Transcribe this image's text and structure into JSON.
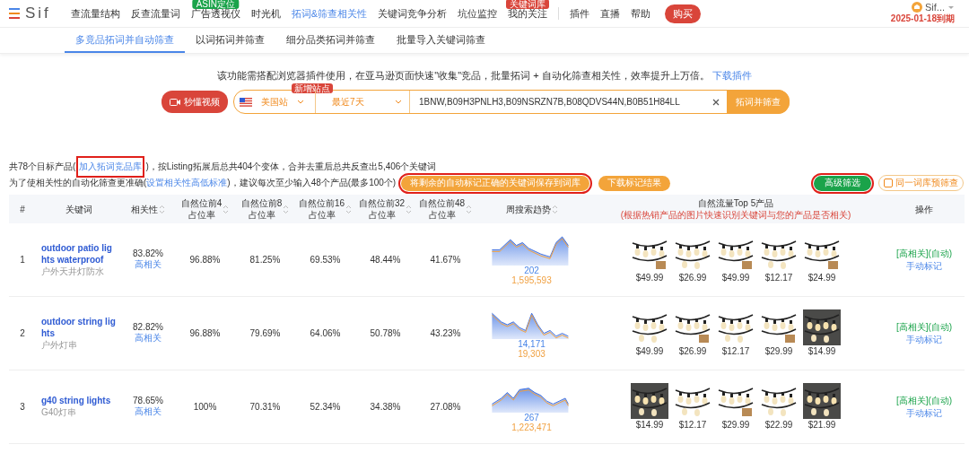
{
  "app": {
    "logo": "Sif",
    "nav": [
      {
        "label": "查流量结构",
        "selected": false
      },
      {
        "label": "反查流量词",
        "selected": false
      },
      {
        "label": "广告透视仪",
        "selected": false,
        "badge": "ASIN定位",
        "color": "#1aa34a"
      },
      {
        "label": "时光机",
        "selected": false
      },
      {
        "label": "拓词&筛查相关性",
        "selected": true
      },
      {
        "label": "关键词竞争分析",
        "selected": false
      },
      {
        "label": "坑位监控",
        "selected": false
      },
      {
        "label": "我的关注",
        "selected": false,
        "badge": "关键词库",
        "color": "#d9453a"
      },
      {
        "label": "插件",
        "selected": false
      },
      {
        "label": "直播",
        "selected": false
      },
      {
        "label": "帮助",
        "selected": false
      }
    ],
    "buy": "购买",
    "user": {
      "name": "Sif...",
      "expiry": "2025-01-18到期"
    }
  },
  "subtabs": [
    {
      "label": "多竟品拓词并自动筛查",
      "selected": true
    },
    {
      "label": "以词拓词并筛查",
      "selected": false
    },
    {
      "label": "细分品类拓词并筛查",
      "selected": false
    },
    {
      "label": "批量导入关键词筛查",
      "selected": false
    }
  ],
  "intro": {
    "text": "该功能需搭配浏览器插件使用，在亚马逊页面快速\"收集\"竞品，批量拓词 + 自动化筛查相关性，效率提升上万倍。",
    "link": "下载插件"
  },
  "search": {
    "video_button": "秒懂视频",
    "site": "美国站",
    "site_badge": "新增站点",
    "period": "最近7天",
    "asins": "1BNW,B09H3PNLH3,B09NSRZN7B,B08QDVS44N,B0B51H84LL",
    "submit": "拓词并筛查"
  },
  "summary": [
    {
      "before": "共78个目标产品(",
      "link": "加入拓词竞品库",
      "after": ")，按Listing拓展后总共404个变体，合并去重后总共反查出5,406个关键词",
      "highlighted": true
    },
    {
      "before": "为了使相关性的自动化筛查更准确(",
      "link": "设置相关性高低标准",
      "after": ")，建议每次至少输入48个产品(最多100个)"
    }
  ],
  "actions": [
    {
      "label": "将剩余的自动标记正确的关键词保存到词库",
      "highlighted": true
    },
    {
      "label": "下载标记结果",
      "highlighted": false
    }
  ],
  "filter_button": {
    "label": "高级筛选",
    "highlighted": true
  },
  "precheck": {
    "label": "同一词库预筛查",
    "checked": false
  },
  "table": {
    "columns": [
      {
        "lines": [
          "#"
        ]
      },
      {
        "lines": [
          "关键词"
        ]
      },
      {
        "lines": [
          "相关性"
        ],
        "sortable": true
      },
      {
        "lines": [
          "自然位前4",
          "占位率"
        ],
        "sortable": true
      },
      {
        "lines": [
          "自然位前8",
          "占位率"
        ],
        "sortable": true
      },
      {
        "lines": [
          "自然位前16",
          "占位率"
        ],
        "sortable": true
      },
      {
        "lines": [
          "自然位前32",
          "占位率"
        ],
        "sortable": true
      },
      {
        "lines": [
          "自然位前48",
          "占位率"
        ],
        "sortable": true
      },
      {
        "lines": [
          "周搜索趋势"
        ],
        "sortable": true
      },
      {
        "lines": [
          "自然流量Top 5产品"
        ],
        "note": "(根据热销产品的图片快速识别关键词与您的产品是否相关)"
      },
      {
        "lines": [
          "操作"
        ]
      }
    ],
    "rows": [
      {
        "number": "1",
        "keyword": "outdoor patio lights waterproof",
        "translation": "户外天井灯防水",
        "relevance": "83.82%",
        "relevance_level": "高相关",
        "rates": [
          "96.88%",
          "81.25%",
          "69.53%",
          "48.44%",
          "41.67%"
        ],
        "trend_primary": "202",
        "trend_secondary": "1,595,593",
        "prices": [
          "$49.99",
          "$26.99",
          "$49.99",
          "$12.17",
          "$24.99"
        ],
        "status": "[高相关](自动)",
        "action": "手动标记"
      },
      {
        "number": "2",
        "keyword": "outdoor string lights",
        "translation": "户外灯串",
        "relevance": "82.82%",
        "relevance_level": "高相关",
        "rates": [
          "96.88%",
          "79.69%",
          "64.06%",
          "50.78%",
          "43.23%"
        ],
        "trend_primary": "14,171",
        "trend_secondary": "19,303",
        "prices": [
          "$49.99",
          "$26.99",
          "$12.17",
          "$29.99",
          "$14.99"
        ],
        "status": "[高相关](自动)",
        "action": "手动标记"
      },
      {
        "number": "3",
        "keyword": "g40 string lights",
        "translation": "G40灯串",
        "relevance": "78.65%",
        "relevance_level": "高相关",
        "rates": [
          "100%",
          "70.31%",
          "52.34%",
          "34.38%",
          "27.08%"
        ],
        "trend_primary": "267",
        "trend_secondary": "1,223,471",
        "prices": [
          "$14.99",
          "$12.17",
          "$29.99",
          "$22.99",
          "$21.99"
        ],
        "status": "[高相关](自动)",
        "action": "手动标记"
      }
    ]
  }
}
